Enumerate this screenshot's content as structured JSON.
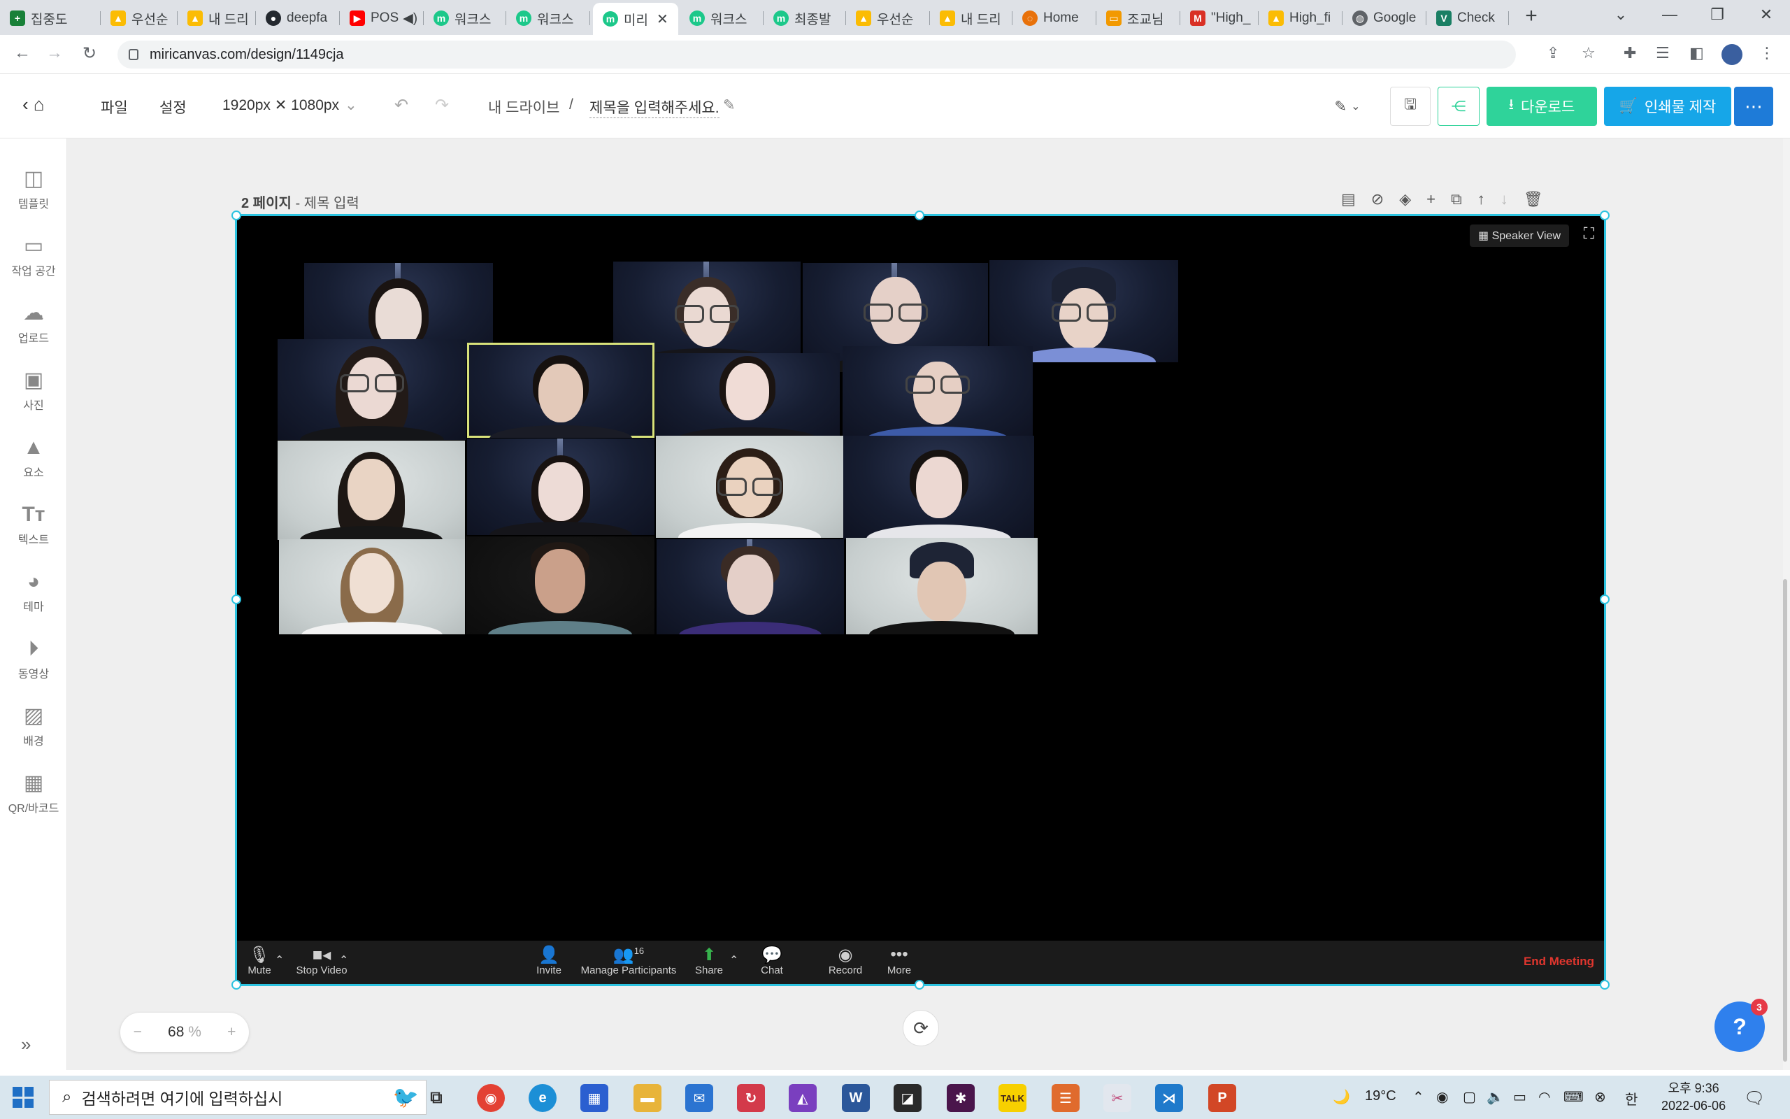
{
  "browser": {
    "tabs": [
      {
        "label": "집중도",
        "icon": "sheets-icon",
        "color": "#188038"
      },
      {
        "label": "우선순",
        "icon": "drive-icon",
        "color": "#fbbc04"
      },
      {
        "label": "내 드리",
        "icon": "drive-icon",
        "color": "#fbbc04"
      },
      {
        "label": "deepfa",
        "icon": "github-icon",
        "color": "#24292f"
      },
      {
        "label": "POS",
        "icon": "youtube-icon",
        "color": "#ff0000"
      },
      {
        "label": "워크스",
        "icon": "miri-icon",
        "color": "#1cc88a"
      },
      {
        "label": "워크스",
        "icon": "miri-icon",
        "color": "#1cc88a"
      },
      {
        "label": "미리",
        "icon": "miri-icon",
        "color": "#1cc88a"
      },
      {
        "label": "워크스",
        "icon": "miri-icon",
        "color": "#1cc88a"
      },
      {
        "label": "최종발",
        "icon": "miri-icon",
        "color": "#1cc88a"
      },
      {
        "label": "우선순",
        "icon": "drive-icon",
        "color": "#fbbc04"
      },
      {
        "label": "내 드리",
        "icon": "drive-icon",
        "color": "#fbbc04"
      },
      {
        "label": "Home",
        "icon": "loading-icon",
        "color": "#e8710a"
      },
      {
        "label": "조교님",
        "icon": "slides-icon",
        "color": "#f29900"
      },
      {
        "label": "\"High_",
        "icon": "gmail-icon",
        "color": "#d93025"
      },
      {
        "label": "High_fi",
        "icon": "drive-icon",
        "color": "#fbbc04"
      },
      {
        "label": "Google",
        "icon": "globe-icon",
        "color": "#5f6368"
      },
      {
        "label": "Check",
        "icon": "check-icon",
        "color": "#1a7f64"
      }
    ],
    "new_tab": "+",
    "url": "miricanvas.com/design/1149cja"
  },
  "header": {
    "menu_file": "파일",
    "menu_settings": "설정",
    "canvas_size": "1920px ✕ 1080px",
    "breadcrumb_root": "내 드라이브",
    "breadcrumb_sep": "/",
    "title": "제목을 입력해주세요.",
    "download": "다운로드",
    "print": "인쇄물 제작"
  },
  "sidebar": {
    "items": [
      {
        "label": "템플릿",
        "icon": "template-icon"
      },
      {
        "label": "작업 공간",
        "icon": "archive-icon"
      },
      {
        "label": "업로드",
        "icon": "upload-icon"
      },
      {
        "label": "사진",
        "icon": "image-icon"
      },
      {
        "label": "요소",
        "icon": "elements-icon"
      },
      {
        "label": "텍스트",
        "icon": "text-icon"
      },
      {
        "label": "테마",
        "icon": "palette-icon"
      },
      {
        "label": "동영상",
        "icon": "play-icon"
      },
      {
        "label": "배경",
        "icon": "pattern-icon"
      },
      {
        "label": "QR/바코드",
        "icon": "qr-icon"
      }
    ]
  },
  "page": {
    "number_label": "2 페이지",
    "title_placeholder": "- 제목 입력"
  },
  "meeting": {
    "speaker_view": "Speaker View",
    "mute": "Mute",
    "stop_video": "Stop Video",
    "invite": "Invite",
    "manage_participants": "Manage Participants",
    "participant_count": "16",
    "share": "Share",
    "chat": "Chat",
    "record": "Record",
    "more": "More",
    "end_meeting": "End Meeting"
  },
  "zoom": {
    "minus": "−",
    "value": "68",
    "unit": "%",
    "plus": "+"
  },
  "help_badge": "3",
  "taskbar": {
    "search_placeholder": "검색하려면 여기에 입력하십시",
    "weather": "19°C",
    "ime": "한",
    "time": "오후 9:36",
    "date": "2022-06-06"
  },
  "colors": {
    "accent_cyan": "#2cc3e0",
    "download_green": "#2fd39a",
    "print_blue": "#16a6e8",
    "more_blue": "#1e7bd8",
    "end_red": "#e0362e"
  }
}
